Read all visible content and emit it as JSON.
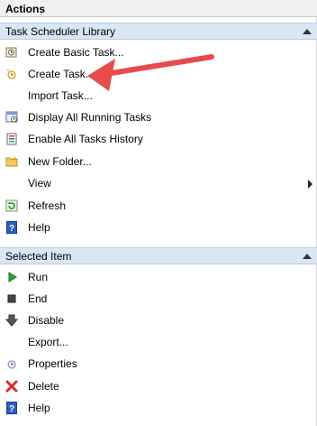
{
  "pane": {
    "title": "Actions"
  },
  "library_section": {
    "title": "Task Scheduler Library",
    "items": [
      {
        "label": "Create Basic Task...",
        "icon": "create-basic-task-icon"
      },
      {
        "label": "Create Task...",
        "icon": "create-task-icon"
      },
      {
        "label": "Import Task...",
        "icon": ""
      },
      {
        "label": "Display All Running Tasks",
        "icon": "running-tasks-icon"
      },
      {
        "label": "Enable All Tasks History",
        "icon": "tasks-history-icon"
      },
      {
        "label": "New Folder...",
        "icon": "folder-icon"
      },
      {
        "label": "View",
        "icon": "",
        "submenu": true
      },
      {
        "label": "Refresh",
        "icon": "refresh-icon"
      },
      {
        "label": "Help",
        "icon": "help-icon"
      }
    ]
  },
  "selected_section": {
    "title": "Selected Item",
    "items": [
      {
        "label": "Run",
        "icon": "run-icon"
      },
      {
        "label": "End",
        "icon": "end-icon"
      },
      {
        "label": "Disable",
        "icon": "disable-icon"
      },
      {
        "label": "Export...",
        "icon": ""
      },
      {
        "label": "Properties",
        "icon": "properties-icon"
      },
      {
        "label": "Delete",
        "icon": "delete-icon"
      },
      {
        "label": "Help",
        "icon": "help-icon"
      }
    ]
  },
  "colors": {
    "header_bg": "#d9e6f4",
    "annotation_arrow": "#e84b4b"
  }
}
